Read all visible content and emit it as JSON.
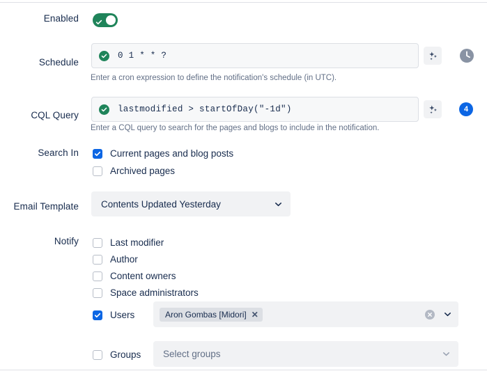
{
  "form": {
    "rows": {
      "enabled": {
        "label": "Enabled",
        "toggle_state": "on",
        "toggle_icon": "check-icon"
      },
      "schedule": {
        "label": "Schedule",
        "value": "0 1 * * ?",
        "status_icon": "valid-check-icon",
        "help": "Enter a cron expression to define the notification's schedule (in UTC).",
        "sparkle_icon": "ai-sparkle-icon",
        "clock_icon": "clock-icon"
      },
      "cql_query": {
        "label": "CQL Query",
        "value": "lastmodified > startOfDay(\"-1d\")",
        "status_icon": "valid-check-icon",
        "help": "Enter a CQL query to search for the pages and blogs to include in the notification.",
        "sparkle_icon": "ai-sparkle-icon",
        "result_count": "4"
      },
      "search_in": {
        "label": "Search In",
        "options": [
          {
            "label": "Current pages and blog posts",
            "checked": true
          },
          {
            "label": "Archived pages",
            "checked": false
          }
        ]
      },
      "email_template": {
        "label": "Email Template",
        "selected": "Contents Updated Yesterday",
        "chevron_icon": "chevron-down-icon"
      },
      "notify": {
        "label": "Notify",
        "options": [
          {
            "label": "Last modifier",
            "checked": false
          },
          {
            "label": "Author",
            "checked": false
          },
          {
            "label": "Content owners",
            "checked": false
          },
          {
            "label": "Space administrators",
            "checked": false
          },
          {
            "label": "Users",
            "checked": true
          },
          {
            "label": "Groups",
            "checked": false
          }
        ],
        "users_field": {
          "chips": [
            {
              "label": "Aron Gombas [Midori]",
              "remove_icon": "close-icon"
            }
          ],
          "clear_icon": "clear-all-icon",
          "chevron_icon": "chevron-down-icon"
        },
        "groups_field": {
          "placeholder": "Select groups",
          "chevron_icon": "chevron-down-icon"
        }
      }
    }
  },
  "colors": {
    "accent_blue": "#0c66e4",
    "success_green": "#1f845a",
    "text": "#172b4d",
    "subtle_text": "#626f86",
    "field_bg": "#f7f8f9",
    "select_bg": "#f1f2f4",
    "chip_bg": "#dcdfe4"
  }
}
